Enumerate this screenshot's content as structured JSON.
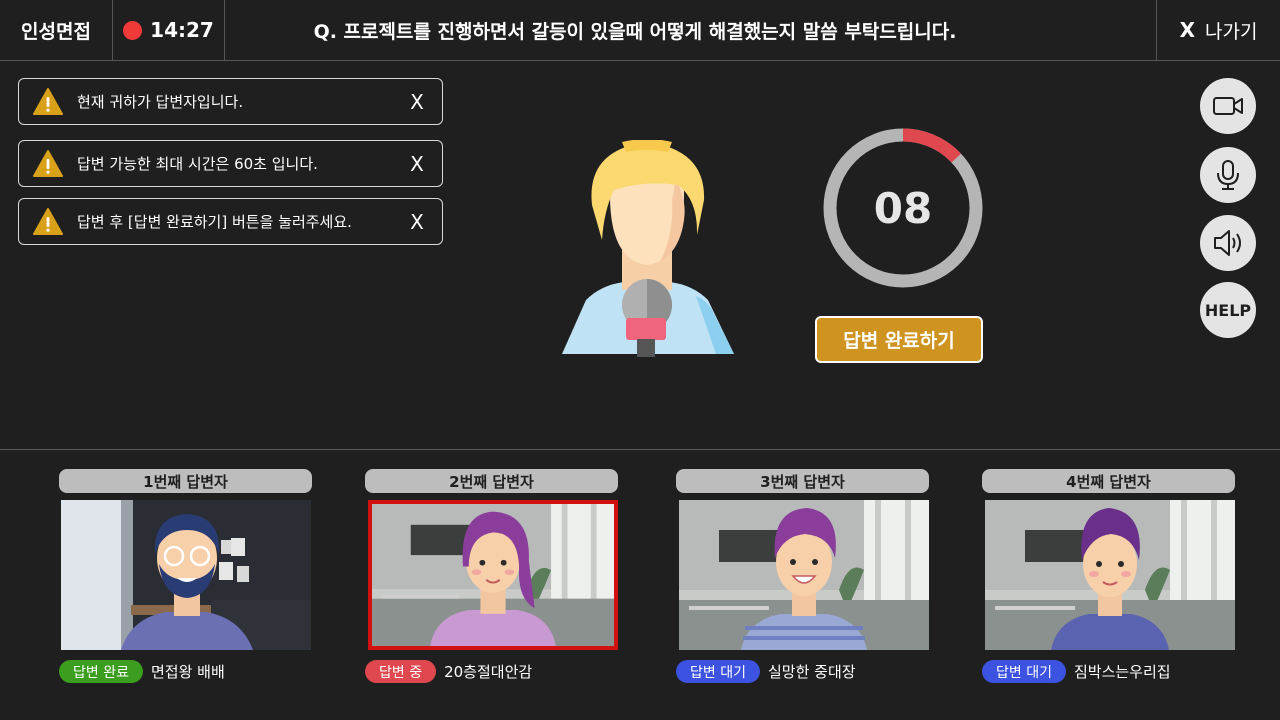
{
  "header": {
    "brand": "인성면접",
    "timer": "14:27",
    "question": "Q. 프로젝트를 진행하면서 갈등이 있을때 어떻게 해결했는지 말씀 부탁드립니다.",
    "exit_x": "X",
    "exit_label": "나가기"
  },
  "alerts": [
    {
      "text": "현재 귀하가 답변자입니다.",
      "close": "X"
    },
    {
      "text": "답변 가능한 최대 시간은 60초 입니다.",
      "close": "X"
    },
    {
      "text": "답변 후 [답변 완료하기] 버튼을 눌러주세요.",
      "close": "X"
    }
  ],
  "countdown": {
    "value": "08",
    "remaining_fraction": 0.87
  },
  "done_button": "답변 완료하기",
  "tools": {
    "camera_icon": "camera-icon",
    "mic_icon": "microphone-icon",
    "speaker_icon": "speaker-icon",
    "help_label": "HELP"
  },
  "participants": [
    {
      "title": "1번째 답변자",
      "status": "답변 완료",
      "status_color": "#3b9e1f",
      "name": "면접왕 배배"
    },
    {
      "title": "2번째 답변자",
      "status": "답변 중",
      "status_color": "#e0484f",
      "name": "20층절대안감"
    },
    {
      "title": "3번째 답변자",
      "status": "답변 대기",
      "status_color": "#3c52e0",
      "name": "실망한 중대장"
    },
    {
      "title": "4번째 답변자",
      "status": "답변 대기",
      "status_color": "#3c52e0",
      "name": "짐박스는우리집"
    }
  ],
  "colors": {
    "background": "#1f1f1f",
    "accent": "#cf9320",
    "recording": "#f03a3a",
    "active_border": "#d11010"
  }
}
